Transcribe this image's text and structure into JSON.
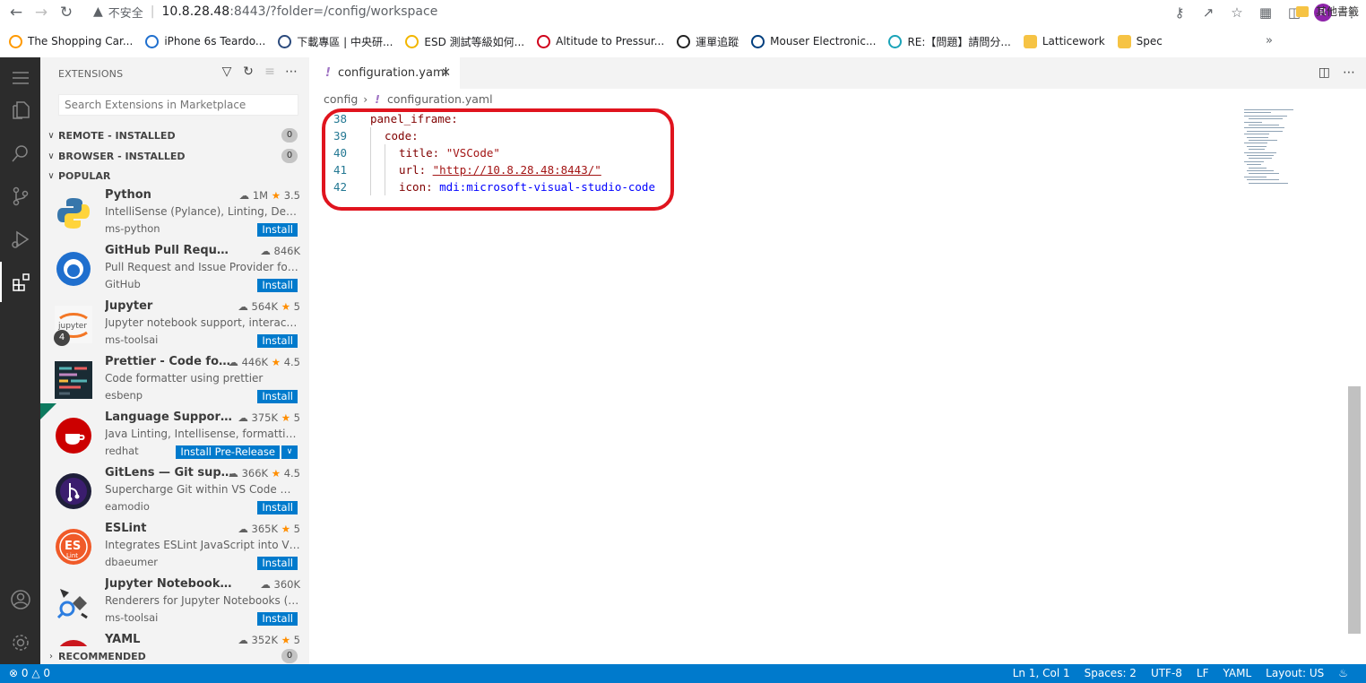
{
  "browser": {
    "insecure_label": "不安全",
    "url_host": "10.8.28.48",
    "url_path": ":8443/?folder=/config/workspace",
    "avatar_letter": "R",
    "bookmarks": [
      {
        "label": "The Shopping Car...",
        "icon": "amazon-icon",
        "color": "#ff9900"
      },
      {
        "label": "iPhone 6s Teardo...",
        "icon": "ifixit-icon",
        "color": "#1f6fce"
      },
      {
        "label": "下載專區 | 中央研...",
        "icon": "academia-icon",
        "color": "#2b4a7c"
      },
      {
        "label": "ESD 測試等級如何...",
        "icon": "trophy-icon",
        "color": "#f2b600"
      },
      {
        "label": "Altitude to Pressur...",
        "icon": "target-icon",
        "color": "#d0021b"
      },
      {
        "label": "運單追蹤",
        "icon": "sf-icon",
        "color": "#222222"
      },
      {
        "label": "Mouser Electronic...",
        "icon": "mouser-icon",
        "color": "#003e7e"
      },
      {
        "label": "RE:【問題】請問分...",
        "icon": "forum-icon",
        "color": "#1aa3b8"
      },
      {
        "label": "Latticework",
        "icon": "folder-icon",
        "color": "#f6c344"
      },
      {
        "label": "Spec",
        "icon": "folder-icon",
        "color": "#f6c344"
      }
    ],
    "bookmarks_more": "»",
    "other_bookmarks": "其他書籤"
  },
  "sidebar": {
    "title": "EXTENSIONS",
    "search_placeholder": "Search Extensions in Marketplace",
    "sections": {
      "remote": {
        "label": "REMOTE - INSTALLED",
        "count": "0"
      },
      "browser": {
        "label": "BROWSER - INSTALLED",
        "count": "0"
      },
      "popular": {
        "label": "POPULAR"
      },
      "recommended": {
        "label": "RECOMMENDED",
        "count": "0"
      }
    },
    "extensions": [
      {
        "name": "Python",
        "downloads": "1M",
        "rating": "3.5",
        "desc": "IntelliSense (Pylance), Linting, Debu...",
        "publisher": "ms-python",
        "action": "Install"
      },
      {
        "name": "GitHub Pull Requests an...",
        "downloads": "846K",
        "rating": "",
        "desc": "Pull Request and Issue Provider for ...",
        "publisher": "GitHub",
        "action": "Install"
      },
      {
        "name": "Jupyter",
        "downloads": "564K",
        "rating": "5",
        "desc": "Jupyter notebook support, interacti...",
        "publisher": "ms-toolsai",
        "action": "Install",
        "badge": "4"
      },
      {
        "name": "Prettier - Code for...",
        "downloads": "446K",
        "rating": "4.5",
        "desc": "Code formatter using prettier",
        "publisher": "esbenp",
        "action": "Install"
      },
      {
        "name": "Language Support f...",
        "downloads": "375K",
        "rating": "5",
        "desc": "Java Linting, Intellisense, formatting,...",
        "publisher": "redhat",
        "action": "Install Pre-Release"
      },
      {
        "name": "GitLens — Git supe...",
        "downloads": "366K",
        "rating": "4.5",
        "desc": "Supercharge Git within VS Code — ...",
        "publisher": "eamodio",
        "action": "Install"
      },
      {
        "name": "ESLint",
        "downloads": "365K",
        "rating": "5",
        "desc": "Integrates ESLint JavaScript into VS ...",
        "publisher": "dbaeumer",
        "action": "Install"
      },
      {
        "name": "Jupyter Notebook Rend...",
        "downloads": "360K",
        "rating": "",
        "desc": "Renderers for Jupyter Notebooks (w...",
        "publisher": "ms-toolsai",
        "action": "Install"
      },
      {
        "name": "YAML",
        "downloads": "352K",
        "rating": "5",
        "desc": "",
        "publisher": "",
        "action": ""
      }
    ]
  },
  "editor": {
    "tab_label": "configuration.yaml",
    "breadcrumb": {
      "folder": "config",
      "file": "configuration.yaml"
    },
    "lines": [
      {
        "num": "38",
        "text": "panel_iframe:"
      },
      {
        "num": "39",
        "text": "code:"
      },
      {
        "num": "40",
        "key": "title: ",
        "value": "\"VSCode\""
      },
      {
        "num": "41",
        "key": "url: ",
        "value": "\"http://10.8.28.48:8443/\""
      },
      {
        "num": "42",
        "key": "icon: ",
        "value": "mdi:microsoft-visual-studio-code"
      }
    ]
  },
  "statusbar": {
    "errors": "0",
    "warnings": "0",
    "position": "Ln 1, Col 1",
    "spaces": "Spaces: 2",
    "encoding": "UTF-8",
    "eol": "LF",
    "language": "YAML",
    "layout": "Layout: US"
  },
  "colors": {
    "accent": "#007acc",
    "highlight_box": "#e0141e",
    "activity_bar": "#2c2c2c"
  }
}
